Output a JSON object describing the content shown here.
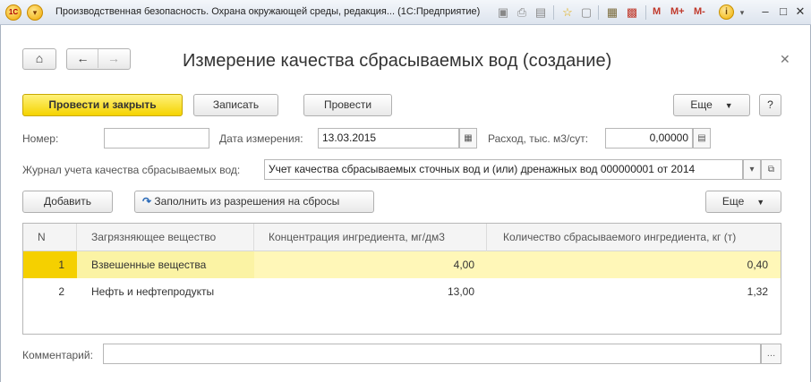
{
  "window": {
    "title": "Производственная безопасность. Охрана окружающей среды, редакция... (1С:Предприятие)",
    "toolbar_m": "M",
    "toolbar_mplus": "M+",
    "toolbar_mminus": "M-"
  },
  "form": {
    "title": "Измерение качества сбрасываемых вод (создание)",
    "buttons": {
      "post_close": "Провести и закрыть",
      "save": "Записать",
      "post": "Провести",
      "more": "Еще",
      "help": "?"
    },
    "fields": {
      "number_label": "Номер:",
      "number_value": "",
      "date_label": "Дата измерения:",
      "date_value": "13.03.2015",
      "flow_label": "Расход, тыс. м3/сут:",
      "flow_value": "0,00000",
      "journal_label": "Журнал учета качества сбрасываемых вод:",
      "journal_value": "Учет качества сбрасываемых сточных вод и (или) дренажных вод 000000001 от 2014",
      "comment_label": "Комментарий:",
      "comment_value": ""
    },
    "table_toolbar": {
      "add": "Добавить",
      "fill": "Заполнить из разрешения на сбросы",
      "more": "Еще"
    },
    "table": {
      "columns": [
        "N",
        "Загрязняющее вещество",
        "Концентрация ингредиента, мг/дм3",
        "Количество сбрасываемого ингредиента, кг (т)"
      ],
      "rows": [
        {
          "n": "1",
          "substance": "Взвешенные вещества",
          "concentration": "4,00",
          "quantity": "0,40"
        },
        {
          "n": "2",
          "substance": "Нефть и нефтепродукты",
          "concentration": "13,00",
          "quantity": "1,32"
        }
      ]
    }
  }
}
